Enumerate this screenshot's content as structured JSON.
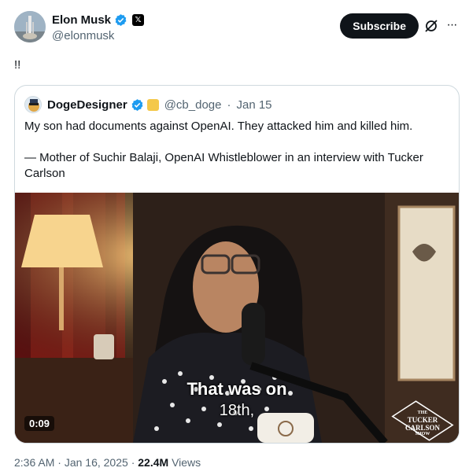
{
  "author": {
    "name": "Elon Musk",
    "handle": "@elonmusk",
    "badge_icon": "verified-badge-icon",
    "affiliate_icon": "x-logo-icon",
    "affiliate_text": "𝕏"
  },
  "actions": {
    "subscribe_label": "Subscribe",
    "grok_icon": "grok-icon",
    "more_label": "···"
  },
  "tweet": {
    "text": "!!"
  },
  "quote": {
    "name": "DogeDesigner",
    "handle": "@cb_doge",
    "separator": "·",
    "date": "Jan 15",
    "text_line1": "My son had documents against OpenAI. They attacked him and killed him.",
    "text_line2": "— Mother of Suchir Balaji, OpenAI Whistleblower in an interview with Tucker Carlson",
    "video": {
      "caption_line1": "That was on",
      "caption_line2": "18th,",
      "duration": "0:09",
      "logo_top": "THE",
      "logo_main1": "TUCKER",
      "logo_main2": "CARLSON",
      "logo_bottom": "SHOW"
    }
  },
  "footer": {
    "time": "2:36 AM",
    "separator": "·",
    "date": "Jan 16, 2025",
    "views_count": "22.4M",
    "views_label": "Views"
  },
  "colors": {
    "verified": "#1d9bf0",
    "text_secondary": "#536471",
    "border": "#cfd9de"
  }
}
